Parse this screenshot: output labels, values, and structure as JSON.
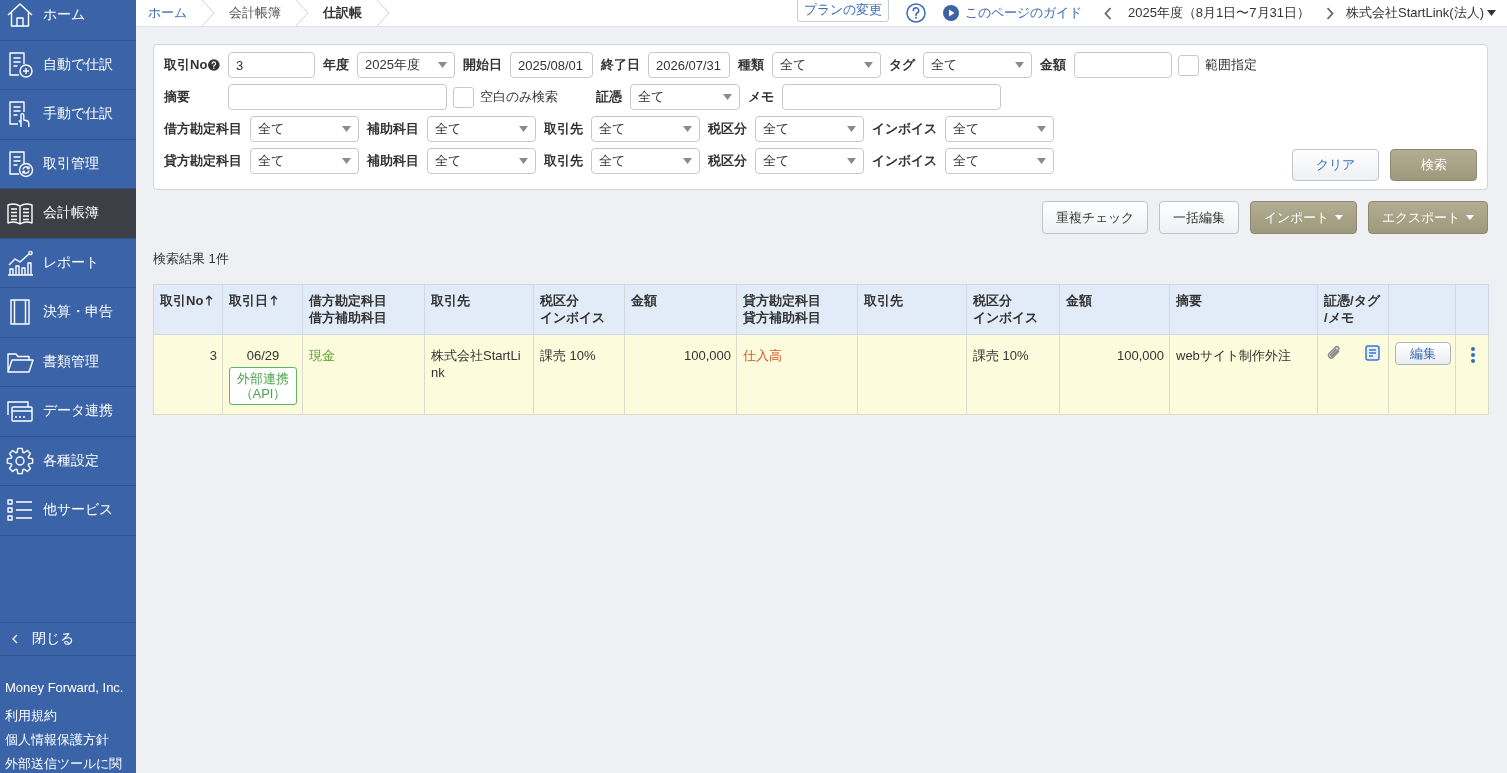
{
  "sidebar": {
    "items": [
      {
        "label": "ホーム",
        "selected": false
      },
      {
        "label": "自動で仕訳",
        "selected": false
      },
      {
        "label": "手動で仕訳",
        "selected": false
      },
      {
        "label": "取引管理",
        "selected": false
      },
      {
        "label": "会計帳簿",
        "selected": true
      },
      {
        "label": "レポート",
        "selected": false
      },
      {
        "label": "決算・申告",
        "selected": false
      },
      {
        "label": "書類管理",
        "selected": false
      },
      {
        "label": "データ連携",
        "selected": false
      },
      {
        "label": "各種設定",
        "selected": false
      },
      {
        "label": "他サービス",
        "selected": false
      }
    ],
    "collapse": "閉じる",
    "company": "Money Forward, Inc.",
    "links": [
      "利用規約",
      "個人情報保護方針",
      "外部送信ツールに関"
    ]
  },
  "breadcrumb": [
    {
      "label": "ホーム",
      "kind": "link"
    },
    {
      "label": "会計帳簿",
      "kind": "parent"
    },
    {
      "label": "仕訳帳",
      "kind": "current"
    }
  ],
  "header": {
    "plan_button": "プランの変更",
    "guide_link": "このページのガイド",
    "period": "2025年度（8月1日〜7月31日）",
    "office": "株式会社StartLink(法人)"
  },
  "filters": {
    "rows": [
      {
        "fields": [
          {
            "kind": "text",
            "label": "取引No",
            "value": "3",
            "help": true
          },
          {
            "kind": "select",
            "label": "年度",
            "value": "2025年度"
          },
          {
            "kind": "text",
            "label": "開始日",
            "value": "2025/08/01"
          },
          {
            "kind": "text",
            "label": "終了日",
            "value": "2026/07/31"
          },
          {
            "kind": "select",
            "label": "種類",
            "value": "全て"
          },
          {
            "kind": "select",
            "label": "タグ",
            "value": "全て"
          },
          {
            "kind": "text",
            "label": "金額"
          },
          {
            "kind": "checkbox",
            "label": "範囲指定",
            "checked": false
          }
        ]
      },
      {
        "fields": [
          {
            "kind": "text",
            "label": "摘要"
          },
          {
            "kind": "checkbox",
            "label": "空白のみ検索",
            "checked": false
          },
          {
            "kind": "select",
            "label": "証憑",
            "value": "全て"
          },
          {
            "kind": "text",
            "label": "メモ"
          }
        ]
      },
      {
        "fields": [
          {
            "kind": "select",
            "label": "借方勘定科目",
            "value": "全て"
          },
          {
            "kind": "select",
            "label": "補助科目",
            "value": "全て"
          },
          {
            "kind": "select",
            "label": "取引先",
            "value": "全て"
          },
          {
            "kind": "select",
            "label": "税区分",
            "value": "全て"
          },
          {
            "kind": "select",
            "label": "インボイス",
            "value": "全て"
          }
        ]
      },
      {
        "fields": [
          {
            "kind": "select",
            "label": "貸方勘定科目",
            "value": "全て"
          },
          {
            "kind": "select",
            "label": "補助科目",
            "value": "全て"
          },
          {
            "kind": "select",
            "label": "取引先",
            "value": "全て"
          },
          {
            "kind": "select",
            "label": "税区分",
            "value": "全て"
          },
          {
            "kind": "select",
            "label": "インボイス",
            "value": "全て"
          }
        ]
      }
    ],
    "buttons": [
      {
        "label": "クリア",
        "kind": "secondary"
      },
      {
        "label": "検索",
        "kind": "primary"
      }
    ]
  },
  "actions": [
    {
      "label": "重複チェック",
      "kind": "default"
    },
    {
      "label": "一括編集",
      "kind": "default"
    },
    {
      "label": "インポート",
      "kind": "primary",
      "dropdown": true
    },
    {
      "label": "エクスポート",
      "kind": "primary",
      "dropdown": true
    }
  ],
  "result_count": "検索結果 1件",
  "table": {
    "columns": [
      {
        "lines": [
          "取引No"
        ],
        "sortable": true
      },
      {
        "lines": [
          "取引日"
        ],
        "sortable": true
      },
      {
        "lines": [
          "借方勘定科目",
          "借方補助科目"
        ]
      },
      {
        "lines": [
          "取引先"
        ]
      },
      {
        "lines": [
          "税区分",
          "インボイス"
        ]
      },
      {
        "lines": [
          "金額"
        ]
      },
      {
        "lines": [
          "貸方勘定科目",
          "貸方補助科目"
        ]
      },
      {
        "lines": [
          "取引先"
        ]
      },
      {
        "lines": [
          "税区分",
          "インボイス"
        ]
      },
      {
        "lines": [
          "金額"
        ]
      },
      {
        "lines": [
          "摘要"
        ]
      },
      {
        "lines": [
          "証憑/タグ",
          "/メモ"
        ]
      }
    ],
    "rows": [
      {
        "no": "3",
        "date": "06/29",
        "badge": "外部連携（API）",
        "debit_account": {
          "text": "現金",
          "color": "#5a9f32"
        },
        "debit_partner": "株式会社StartLink",
        "debit_tax": "課売 10%",
        "debit_amount": "100,000",
        "credit_account": {
          "text": "仕入高",
          "color": "#d4552b"
        },
        "credit_tax": "課売 10%",
        "credit_amount": "100,000",
        "description": "webサイト制作外注",
        "attachment": true,
        "memo": true,
        "edit_button": "編集"
      }
    ]
  }
}
